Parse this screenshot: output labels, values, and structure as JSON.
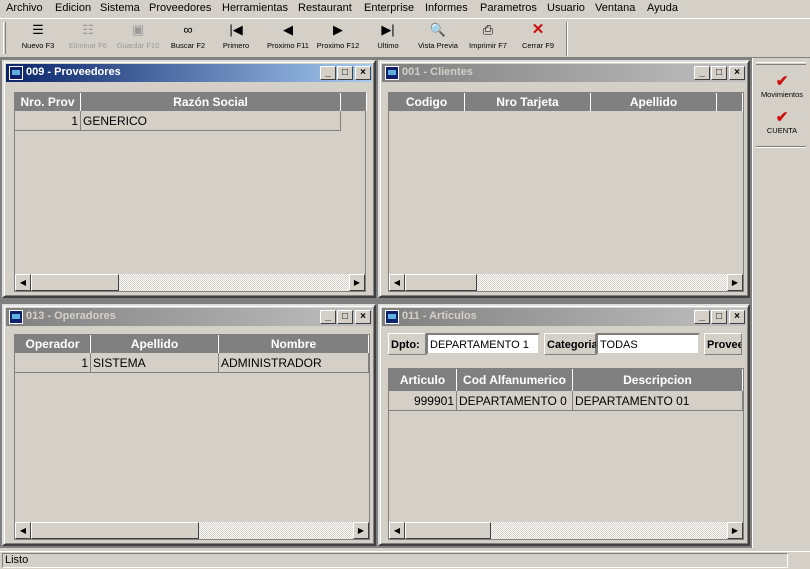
{
  "menu": [
    "Archivo",
    "Edicion",
    "Sistema",
    "Proveedores",
    "Herramientas",
    "Restaurant",
    "Enterprise",
    "Informes",
    "Parametros",
    "Usuario",
    "Ventana",
    "Ayuda"
  ],
  "toolbar": [
    {
      "label": "Nuevo F3",
      "icon": "new-icon",
      "enabled": true
    },
    {
      "label": "Eliminar F6",
      "icon": "delete-icon",
      "enabled": false
    },
    {
      "label": "Guardar F10",
      "icon": "save-icon",
      "enabled": false
    },
    {
      "label": "Buscar F2",
      "icon": "binoculars-icon",
      "enabled": true
    },
    {
      "label": "Primero",
      "icon": "first-icon",
      "enabled": true
    },
    {
      "label": "Proximo F11",
      "icon": "previous-icon",
      "enabled": true
    },
    {
      "label": "Proximo F12",
      "icon": "next-icon",
      "enabled": true
    },
    {
      "label": "Ultimo",
      "icon": "last-icon",
      "enabled": true
    },
    {
      "label": "Vista Previa",
      "icon": "preview-icon",
      "enabled": true
    },
    {
      "label": "Imprimir F7",
      "icon": "printer-icon",
      "enabled": true
    },
    {
      "label": "Cerrar F9",
      "icon": "close-red-icon",
      "enabled": true
    }
  ],
  "windows": {
    "proveedores": {
      "title": "009 - Proveedores",
      "active": true,
      "columns": [
        "Nro. Prov",
        "Razón Social"
      ],
      "rows": [
        [
          "1",
          "GENERICO"
        ]
      ]
    },
    "clientes": {
      "title": "001 - Clientes",
      "active": false,
      "columns": [
        "Codigo",
        "Nro Tarjeta",
        "Apellido"
      ],
      "rows": []
    },
    "operadores": {
      "title": "013 - Operadores",
      "active": false,
      "columns": [
        "Operador",
        "Apellido",
        "Nombre"
      ],
      "rows": [
        [
          "1",
          "SISTEMA",
          "ADMINISTRADOR"
        ]
      ]
    },
    "articulos": {
      "title": "011 - Articulos",
      "active": false,
      "filters": {
        "dpto_label": "Dpto:",
        "dpto_value": "DEPARTAMENTO 1",
        "categoria_label": "Categoria:",
        "categoria_value": "TODAS",
        "proveedor_label": "Provee"
      },
      "columns": [
        "Articulo",
        "Cod Alfanumerico",
        "Descripcion"
      ],
      "rows": [
        [
          "999901",
          "DEPARTAMENTO 0",
          "DEPARTAMENTO 01"
        ]
      ]
    }
  },
  "right_panel": [
    {
      "label": "Movimientos",
      "icon": "checkmark-icon"
    },
    {
      "label": "CUENTA",
      "icon": "checkmark-icon"
    }
  ],
  "status": {
    "text": "Listo"
  },
  "colors": {
    "active_title": "#0a246a",
    "inactive_title": "#808080",
    "grid_header": "#808080",
    "face": "#d4d0c8",
    "close_red": "#cc1010"
  }
}
